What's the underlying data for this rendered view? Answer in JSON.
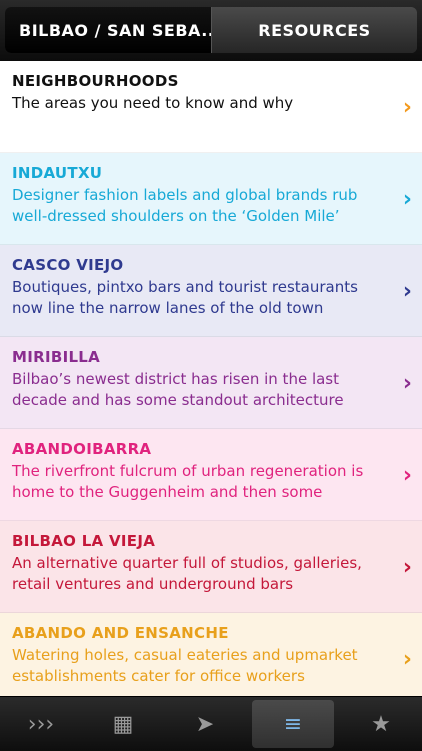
{
  "header": {
    "left_label": "BILBAO / SAN SEBA...",
    "right_label": "RESOURCES"
  },
  "list": [
    {
      "title": "NEIGHBOURHOODS",
      "description": "The areas you need to know and why",
      "color": "#111111",
      "bg": "#ffffff",
      "chevron_color": "#f39a1e"
    },
    {
      "title": "INDAUTXU",
      "description": "Designer fashion labels and global brands rub well-dressed shoulders on the ‘Golden Mile’",
      "color": "#17a9d6",
      "bg": "#e6f6fc",
      "chevron_color": "#17a9d6"
    },
    {
      "title": "CASCO VIEJO",
      "description": "Boutiques, pintxo bars and tourist restaurants now line the narrow lanes of the old town",
      "color": "#2f3a8f",
      "bg": "#e8e9f5",
      "chevron_color": "#2f3a8f"
    },
    {
      "title": "MIRIBILLA",
      "description": "Bilbao’s newest district has risen in the last decade and has some standout architecture",
      "color": "#8a2d8f",
      "bg": "#f3e6f4",
      "chevron_color": "#8a2d8f"
    },
    {
      "title": "ABANDOIBARRA",
      "description": "The riverfront fulcrum of urban regeneration is home to the Guggenheim and then some",
      "color": "#e0237e",
      "bg": "#fde6f1",
      "chevron_color": "#e0237e"
    },
    {
      "title": "BILBAO LA VIEJA",
      "description": "An alternative quarter full of studios, galleries, retail ventures and underground bars",
      "color": "#c4183a",
      "bg": "#fbe4e8",
      "chevron_color": "#c4183a"
    },
    {
      "title": "ABANDO AND ENSANCHE",
      "description": "Watering holes, casual eateries and upmarket establishments cater for office workers",
      "color": "#e8a01c",
      "bg": "#fdf3e2",
      "chevron_color": "#e8a01c"
    }
  ],
  "tabbar": {
    "items": [
      {
        "icon": "chevrons-icon",
        "glyph": "›››"
      },
      {
        "icon": "grid-icon",
        "glyph": "▦"
      },
      {
        "icon": "location-arrow-icon",
        "glyph": "➤"
      },
      {
        "icon": "list-icon",
        "glyph": "≡"
      },
      {
        "icon": "star-icon",
        "glyph": "★"
      }
    ],
    "active_index": 3
  }
}
